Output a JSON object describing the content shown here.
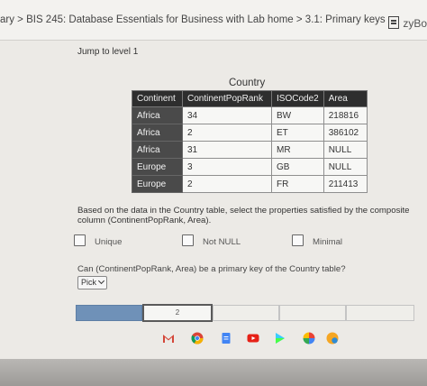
{
  "header": {
    "breadcrumb": "ary > BIS 245: Database Essentials for Business with Lab home > 3.1: Primary keys",
    "brand": "zyBo"
  },
  "jump": "Jump to level 1",
  "table": {
    "caption": "Country",
    "columns": [
      "Continent",
      "ContinentPopRank",
      "ISOCode2",
      "Area"
    ],
    "rows": [
      [
        "Africa",
        "34",
        "BW",
        "218816"
      ],
      [
        "Africa",
        "2",
        "ET",
        "386102"
      ],
      [
        "Africa",
        "31",
        "MR",
        "NULL"
      ],
      [
        "Europe",
        "3",
        "GB",
        "NULL"
      ],
      [
        "Europe",
        "2",
        "FR",
        "211413"
      ]
    ]
  },
  "question": "Based on the data in the Country table, select the properties satisfied by the composite column (ContinentPopRank, Area).",
  "options": [
    "Unique",
    "Not NULL",
    "Minimal"
  ],
  "question2": "Can (ContinentPopRank, Area) be a primary key of the Country table?",
  "pick": "Pick",
  "progress": {
    "current_label": "2",
    "completed": 1,
    "total": 5
  },
  "colors": {
    "progress_done": "#6f91b8",
    "header_dark": "#2e2e2e"
  }
}
